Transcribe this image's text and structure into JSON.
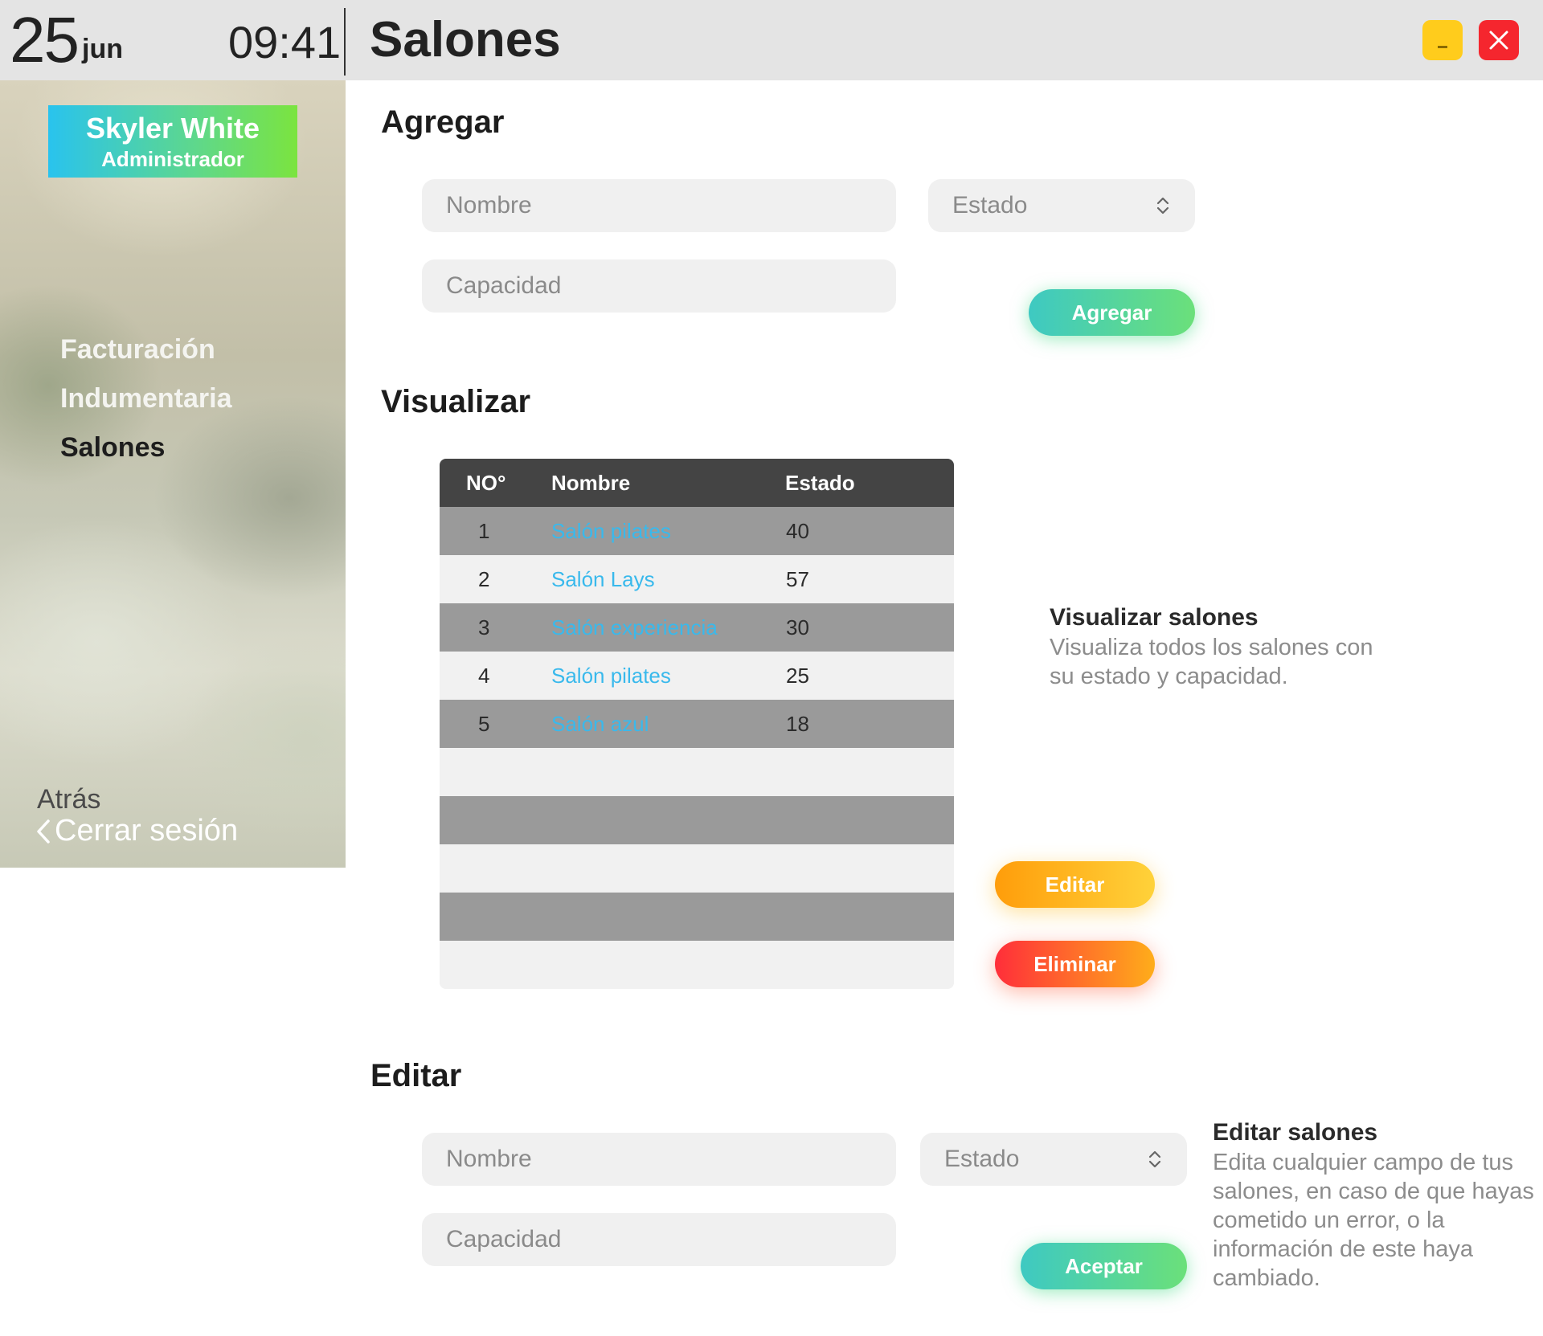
{
  "topbar": {
    "day": "25",
    "month": "jun",
    "time": "09:41",
    "title": "Salones",
    "minimize_icon": "minimize-icon",
    "close_icon": "close-icon",
    "minimize_color": "#ffcc1c",
    "close_color": "#f5262e"
  },
  "sidebar": {
    "user": {
      "name": "Skyler White",
      "role": "Administrador"
    },
    "nav": [
      {
        "label": "Facturación",
        "active": false
      },
      {
        "label": "Indumentaria",
        "active": false
      },
      {
        "label": "Salones",
        "active": true
      }
    ],
    "back_label": "Atrás",
    "logout_label": "Cerrar sesión",
    "logout_icon": "chevron-left-icon"
  },
  "add_section": {
    "title": "Agregar",
    "name_placeholder": "Nombre",
    "state_placeholder": "Estado",
    "capacity_placeholder": "Capacidad",
    "submit_label": "Agregar"
  },
  "view_section": {
    "title": "Visualizar",
    "table": {
      "headers": [
        "NO°",
        "Nombre",
        "Estado"
      ],
      "rows": [
        {
          "no": "1",
          "name": "Salón pilates",
          "value": "40"
        },
        {
          "no": "2",
          "name": "Salón Lays",
          "value": "57"
        },
        {
          "no": "3",
          "name": "Salón experiencia",
          "value": "30"
        },
        {
          "no": "4",
          "name": "Salón pilates",
          "value": "25"
        },
        {
          "no": "5",
          "name": "Salón azul",
          "value": "18"
        }
      ]
    },
    "info_title": "Visualizar salones",
    "info_line1": "Visualiza todos los salones con",
    "info_line2": "su estado y capacidad.",
    "edit_label": "Editar",
    "delete_label": "Eliminar"
  },
  "edit_section": {
    "title": "Editar",
    "name_placeholder": "Nombre",
    "state_placeholder": "Estado",
    "capacity_placeholder": "Capacidad",
    "submit_label": "Aceptar",
    "info_title": "Editar salones",
    "info_lines": [
      "Edita cualquier campo de tus",
      "salones, en caso de que hayas",
      "cometido un error, o la",
      "información de este haya",
      "cambiado."
    ]
  }
}
